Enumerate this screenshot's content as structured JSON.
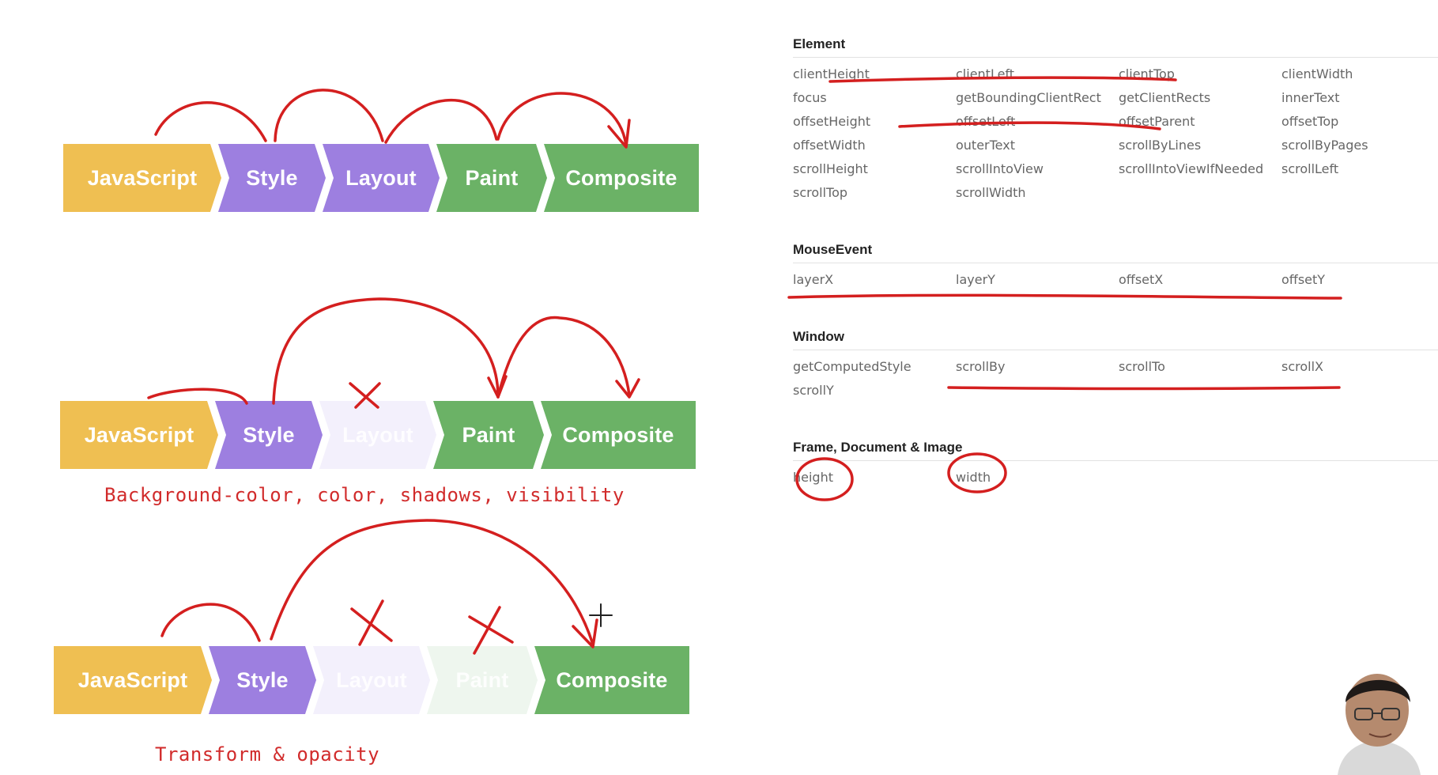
{
  "colors": {
    "javascript": "#efbf52",
    "style": "#9d7fe0",
    "layout": "#9d7fe0",
    "paint": "#6bb266",
    "composite": "#6bb266",
    "layout_faded": "#f3f0fc",
    "paint_faded": "#eef6ee",
    "annotation": "#d41f1f"
  },
  "pipelines": [
    {
      "stages": [
        {
          "label": "JavaScript",
          "state": "active"
        },
        {
          "label": "Style",
          "state": "active"
        },
        {
          "label": "Layout",
          "state": "active"
        },
        {
          "label": "Paint",
          "state": "active"
        },
        {
          "label": "Composite",
          "state": "active"
        }
      ],
      "caption": ""
    },
    {
      "stages": [
        {
          "label": "JavaScript",
          "state": "active"
        },
        {
          "label": "Style",
          "state": "active"
        },
        {
          "label": "Layout",
          "state": "skipped"
        },
        {
          "label": "Paint",
          "state": "active"
        },
        {
          "label": "Composite",
          "state": "active"
        }
      ],
      "caption": "Background-color, color, shadows, visibility"
    },
    {
      "stages": [
        {
          "label": "JavaScript",
          "state": "active"
        },
        {
          "label": "Style",
          "state": "active"
        },
        {
          "label": "Layout",
          "state": "skipped"
        },
        {
          "label": "Paint",
          "state": "skipped"
        },
        {
          "label": "Composite",
          "state": "active"
        }
      ],
      "caption": "Transform & opacity"
    }
  ],
  "api_sections": [
    {
      "title": "Element",
      "items": [
        "clientHeight",
        "clientLeft",
        "clientTop",
        "clientWidth",
        "focus",
        "getBoundingClientRect",
        "getClientRects",
        "innerText",
        "offsetHeight",
        "offsetLeft",
        "offsetParent",
        "offsetTop",
        "offsetWidth",
        "outerText",
        "scrollByLines",
        "scrollByPages",
        "scrollHeight",
        "scrollIntoView",
        "scrollIntoViewIfNeeded",
        "scrollLeft",
        "scrollTop",
        "scrollWidth"
      ]
    },
    {
      "title": "MouseEvent",
      "items": [
        "layerX",
        "layerY",
        "offsetX",
        "offsetY"
      ]
    },
    {
      "title": "Window",
      "items": [
        "getComputedStyle",
        "scrollBy",
        "scrollTo",
        "scrollX",
        "scrollY"
      ]
    },
    {
      "title": "Frame, Document & Image",
      "items": [
        "height",
        "width"
      ]
    }
  ]
}
